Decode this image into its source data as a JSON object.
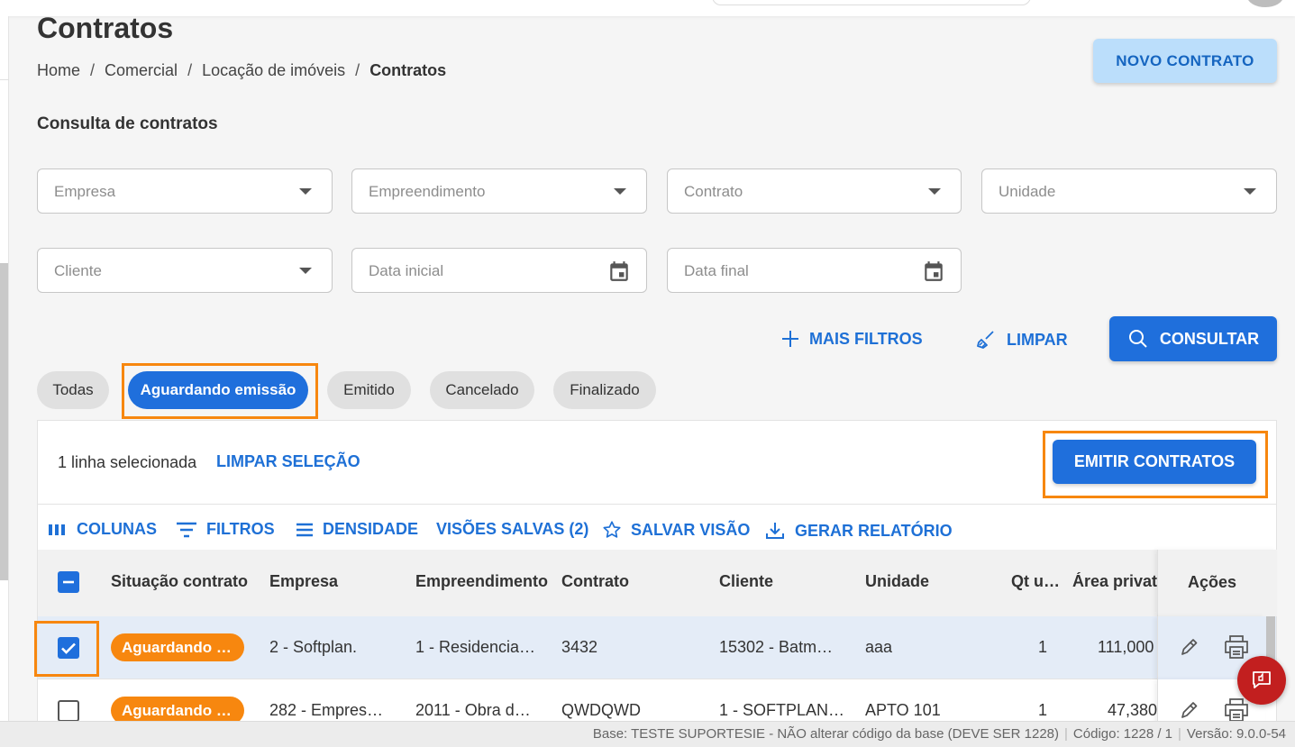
{
  "page": {
    "title": "Contratos",
    "breadcrumb": [
      "Home",
      "Comercial",
      "Locação de imóveis",
      "Contratos"
    ],
    "new_button": "NOVO CONTRATO",
    "section_title": "Consulta de contratos"
  },
  "filters": {
    "empresa": "Empresa",
    "empreendimento": "Empreendimento",
    "contrato": "Contrato",
    "unidade": "Unidade",
    "cliente": "Cliente",
    "data_inicial": "Data inicial",
    "data_final": "Data final"
  },
  "actions": {
    "more_filters": "MAIS FILTROS",
    "clear": "LIMPAR",
    "search": "CONSULTAR"
  },
  "status_tabs": [
    "Todas",
    "Aguardando emissão",
    "Emitido",
    "Cancelado",
    "Finalizado"
  ],
  "active_tab": "Aguardando emissão",
  "selection": {
    "text": "1 linha selecionada",
    "clear_label": "LIMPAR SELEÇÃO",
    "emit_button": "EMITIR CONTRATOS"
  },
  "toolbar": {
    "columns": "COLUNAS",
    "filters": "FILTROS",
    "density": "DENSIDADE",
    "saved_views": "VISÕES SALVAS (2)",
    "save_view": "SALVAR VISÃO",
    "report": "GERAR RELATÓRIO"
  },
  "grid": {
    "columns": [
      "Situação contrato",
      "Empresa",
      "Empreendimento",
      "Contrato",
      "Cliente",
      "Unidade",
      "Qt u…",
      "Área privat",
      "Ações"
    ],
    "rows": [
      {
        "selected": true,
        "situacao": "Aguardando …",
        "empresa": "2 - Softplan.",
        "empreendimento": "1 - Residencia…",
        "contrato": "3432",
        "cliente": "15302 - Batm…",
        "unidade": "aaa",
        "qt": "1",
        "area": "111,000"
      },
      {
        "selected": false,
        "situacao": "Aguardando …",
        "empresa": "282 - Empres…",
        "empreendimento": "2011 - Obra d…",
        "contrato": "QWDQWD",
        "cliente": "1 - SOFTPLAN…",
        "unidade": "APTO 101",
        "qt": "1",
        "area": "47,380"
      }
    ]
  },
  "footer": {
    "base": "Base: TESTE SUPORTESIE - NÃO alterar código da base (DEVE SER 1228)",
    "codigo": "Código: 1228 / 1",
    "versao": "Versão: 9.0.0-54"
  },
  "colors": {
    "primary": "#1f6fdc",
    "accent_light": "#bbdefb",
    "status_orange": "#f7870f",
    "fab_red": "#c21f1f"
  }
}
